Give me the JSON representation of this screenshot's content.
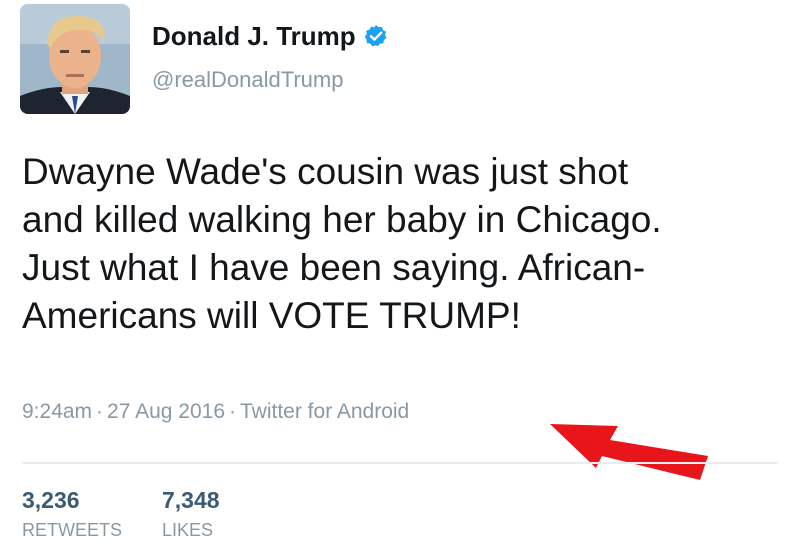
{
  "profile": {
    "display_name": "Donald J. Trump",
    "handle": "@realDonaldTrump",
    "verified_icon": "verified-badge-icon",
    "verified_color": "#1da1f2"
  },
  "tweet": {
    "lines": [
      "Dwayne Wade's cousin was just shot",
      "and killed walking her baby in Chicago.",
      "Just what I have been saying. African-",
      "Americans will VOTE TRUMP!"
    ]
  },
  "meta": {
    "time": "9:24am",
    "separator": "·",
    "date": "27 Aug 2016",
    "source": "Twitter for Android"
  },
  "stats": {
    "retweets_count": "3,236",
    "retweets_label": "RETWEETS",
    "likes_count": "7,348",
    "likes_label": "LIKES"
  },
  "annotation": {
    "arrow_color": "#e8161b",
    "arrow_icon": "red-arrow-icon"
  }
}
